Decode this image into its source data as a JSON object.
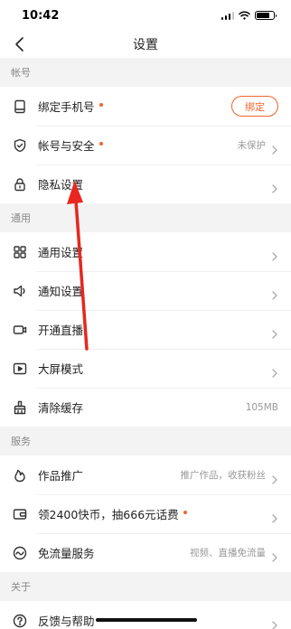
{
  "status": {
    "time": "10:42"
  },
  "nav": {
    "title": "设置"
  },
  "sections": {
    "account": {
      "header": "帐号",
      "bind_phone": {
        "label": "绑定手机号",
        "button": "绑定"
      },
      "security": {
        "label": "帐号与安全",
        "value": "未保护"
      },
      "privacy": {
        "label": "隐私设置"
      }
    },
    "general": {
      "header": "通用",
      "general_settings": {
        "label": "通用设置"
      },
      "notifications": {
        "label": "通知设置"
      },
      "live": {
        "label": "开通直播"
      },
      "big_screen": {
        "label": "大屏模式"
      },
      "cache": {
        "label": "清除缓存",
        "value": "105MB"
      }
    },
    "service": {
      "header": "服务",
      "promotion": {
        "label": "作品推广",
        "value": "推广作品，收获粉丝"
      },
      "coins": {
        "label": "领2400快币，抽666元话费"
      },
      "free_data": {
        "label": "免流量服务",
        "value": "视频、直播免流量"
      }
    },
    "about": {
      "header": "关于",
      "feedback": {
        "label": "反馈与帮助"
      }
    }
  },
  "colors": {
    "accent": "#f0642e",
    "annotation_arrow": "#e8261f"
  },
  "icons": [
    "phone-icon",
    "shield-icon",
    "lock-icon",
    "grid-icon",
    "speaker-icon",
    "camera-icon",
    "play-screen-icon",
    "broom-icon",
    "flame-icon",
    "coin-card-icon",
    "wave-icon",
    "help-icon"
  ]
}
